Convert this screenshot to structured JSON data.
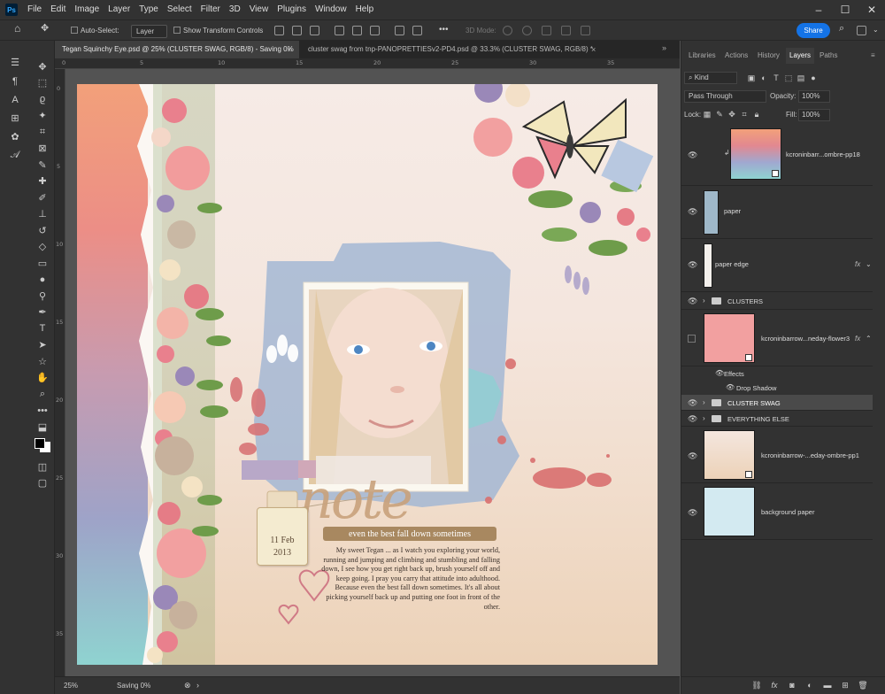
{
  "menu": {
    "items": [
      "File",
      "Edit",
      "Image",
      "Layer",
      "Type",
      "Select",
      "Filter",
      "3D",
      "View",
      "Plugins",
      "Window",
      "Help"
    ]
  },
  "options": {
    "auto_select": "Auto-Select:",
    "layer_mode": "Layer",
    "show_transform": "Show Transform Controls",
    "mode_3d": "3D Mode:",
    "more": "•••",
    "share": "Share"
  },
  "tabs": [
    {
      "label": "Tegan Squinchy Eye.psd @ 25% (CLUSTER SWAG, RGB/8) - Saving 0%",
      "close": "×"
    },
    {
      "label": "cluster swag from tnp-PANOPRETTIESv2-PD4.psd @ 33.3% (CLUSTER SWAG, RGB/8) *",
      "close": "×"
    }
  ],
  "ruler": {
    "top": [
      "0",
      "5",
      "10",
      "15",
      "20",
      "25",
      "30",
      "35"
    ],
    "left": [
      "0",
      "5",
      "10",
      "15",
      "20",
      "25",
      "30",
      "35"
    ]
  },
  "canvas": {
    "title": "note",
    "subtitle": "even the best fall down sometimes",
    "date_line1": "11 Feb",
    "date_line2": "2013",
    "journal": "My sweet Tegan ... as I watch you exploring your world, running and jumping and climbing and stumbling and falling down, I see how you get right back up, brush yourself off and keep going. I pray you carry that attitude into adulthood. Because even the best fall down sometimes. It's all about picking yourself back up and putting one foot in front of the other."
  },
  "status": {
    "zoom": "25%",
    "saving": "Saving 0%"
  },
  "panel": {
    "tabs": [
      "Libraries",
      "Actions",
      "History",
      "Layers",
      "Paths"
    ],
    "filter_kind": "Kind",
    "blend": "Pass Through",
    "opacity_label": "Opacity:",
    "opacity": "100%",
    "lock_label": "Lock:",
    "fill_label": "Fill:",
    "fill": "100%",
    "layers": [
      {
        "name": "kcroninbarr...ombre-pp18"
      },
      {
        "name": "paper"
      },
      {
        "name": "paper edge",
        "fx": "fx"
      },
      {
        "name": "CLUSTERS"
      },
      {
        "name": "kcroninbarrow...neday-flower3",
        "fx": "fx"
      },
      {
        "name": "Effects"
      },
      {
        "name": "Drop Shadow"
      },
      {
        "name": "CLUSTER SWAG"
      },
      {
        "name": "EVERYTHING ELSE"
      },
      {
        "name": "kcroninbarrow-...eday-ombre-pp1"
      },
      {
        "name": "background paper"
      }
    ]
  },
  "colors": {
    "accent": "#1473e6",
    "panel_bg": "#323232",
    "selected_row": "#4a4a4a"
  }
}
